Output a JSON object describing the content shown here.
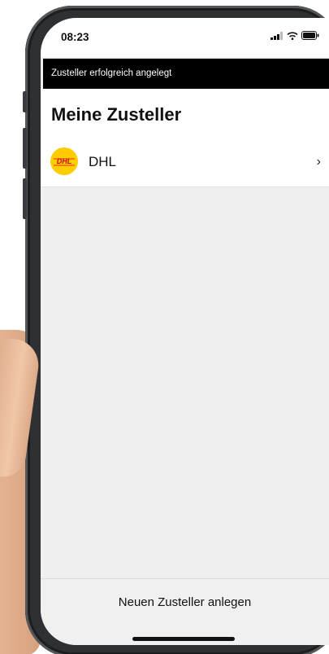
{
  "status_bar": {
    "time": "08:23",
    "icons": [
      "signal-icon",
      "wifi-icon",
      "battery-icon"
    ]
  },
  "toast": {
    "message": "Zusteller erfolgreich angelegt"
  },
  "header": {
    "title": "Meine Zusteller"
  },
  "carriers": [
    {
      "name": "DHL",
      "logo_text": "DHL",
      "logo_color": "#ffcc00",
      "logo_text_color": "#d40511",
      "icon": "chevron-right-icon"
    }
  ],
  "footer": {
    "add_button_label": "Neuen Zusteller anlegen"
  },
  "colors": {
    "toast_background": "#000000",
    "screen_background": "#efefef"
  }
}
